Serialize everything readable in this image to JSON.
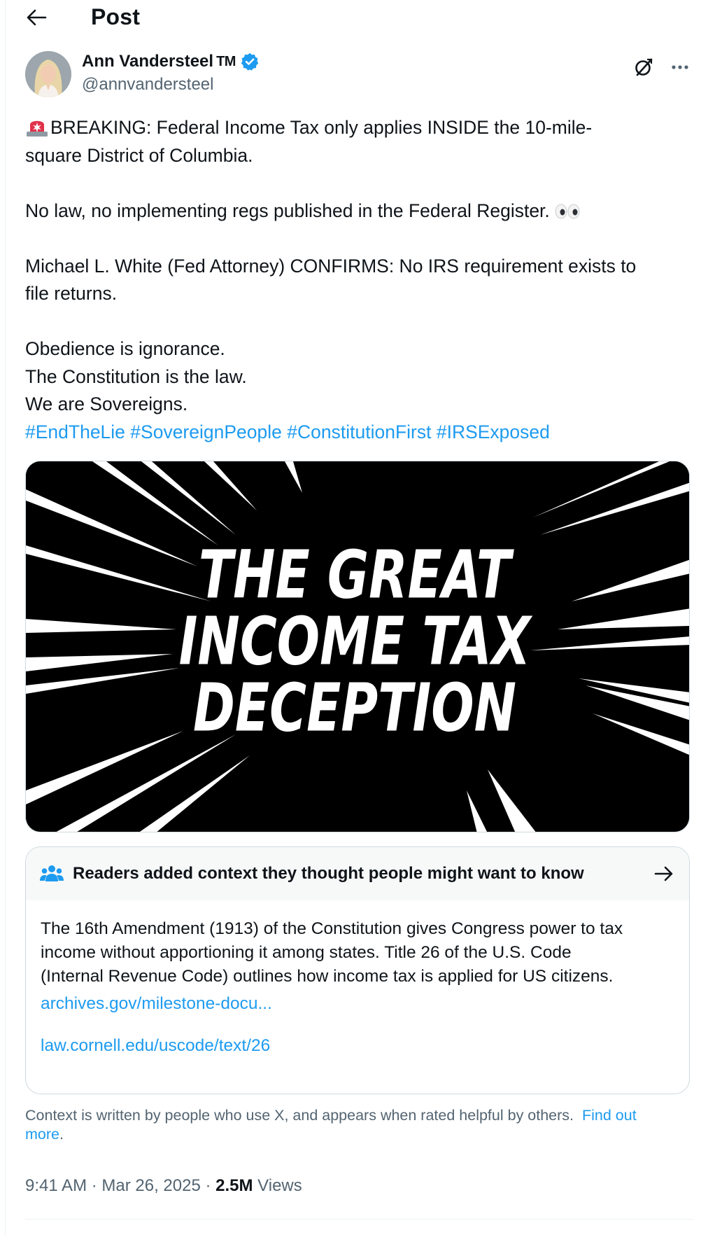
{
  "header": {
    "title": "Post"
  },
  "author": {
    "name": "Ann Vandersteel",
    "name_suffix": "TM",
    "handle": "@annvandersteel"
  },
  "post": {
    "line1": "BREAKING: Federal Income Tax only applies INSIDE the 10-mile-",
    "line2": "square District of Columbia.",
    "line3": "No law, no implementing regs published in the Federal Register.",
    "line4": "Michael L. White (Fed Attorney) CONFIRMS: No IRS requirement exists to",
    "line5": "file returns.",
    "line6": "Obedience is ignorance.",
    "line7": "The Constitution is the law.",
    "line8": "We are Sovereigns.",
    "hashtags": [
      "#EndTheLie",
      "#SovereignPeople",
      "#ConstitutionFirst",
      "#IRSExposed"
    ]
  },
  "media": {
    "text_line1": "THE GREAT",
    "text_line2": "INCOME TAX",
    "text_line3": "DECEPTION"
  },
  "community_note": {
    "title": "Readers added context they thought people might want to know",
    "body_line1": "The 16th Amendment (1913) of the Constitution gives Congress power to tax",
    "body_line2": "income without apportioning it among states. Title 26 of the U.S. Code",
    "body_line3": "(Internal Revenue Code) outlines how income tax is applied for US citizens.",
    "link1": "archives.gov/milestone-docu...",
    "link2": "law.cornell.edu/uscode/text/26",
    "disclaimer": "Context is written by people who use X, and appears when rated helpful by others.",
    "find_out_more_line1": "Find out",
    "find_out_more_line2": "more",
    "trailing": "."
  },
  "meta": {
    "time": "9:41 AM",
    "separator": " · ",
    "date": "Mar 26, 2025",
    "views_count": "2.5M",
    "views_label": " Views"
  },
  "colors": {
    "accent": "#1d9bf0",
    "text": "#0f1419",
    "secondary": "#536471",
    "border": "#cfd9de"
  }
}
